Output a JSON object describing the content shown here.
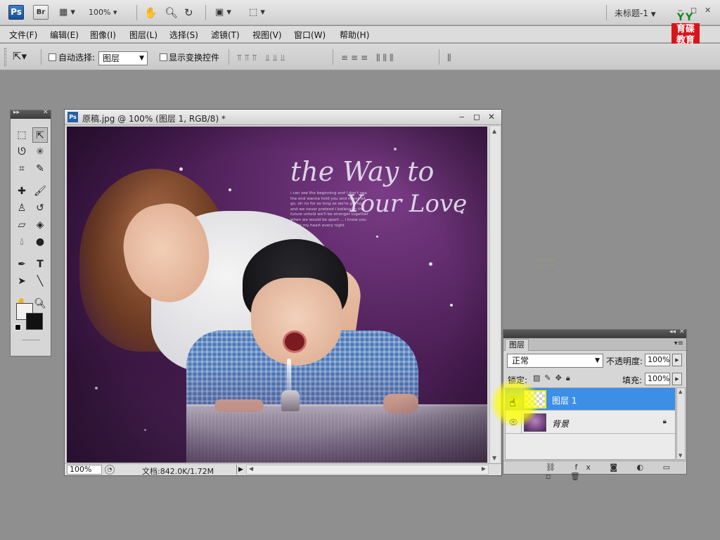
{
  "appbar": {
    "ps_logo": "Ps",
    "br_logo": "Br",
    "zoom": "100%",
    "doc_title": "未标题-1",
    "dropdown_glyph": "▼",
    "minimize_glyph": "‒",
    "restore_glyph": "◻",
    "close_glyph": "✕",
    "edu_top": "YY",
    "edu_line1": "育碟",
    "edu_line2": "教育"
  },
  "menu": {
    "items": [
      {
        "label": "文件(F)"
      },
      {
        "label": "编辑(E)"
      },
      {
        "label": "图像(I)"
      },
      {
        "label": "图层(L)"
      },
      {
        "label": "选择(S)"
      },
      {
        "label": "滤镜(T)"
      },
      {
        "label": "视图(V)"
      },
      {
        "label": "窗口(W)"
      },
      {
        "label": "帮助(H)"
      }
    ]
  },
  "options": {
    "auto_select_label": "自动选择:",
    "auto_select_value": "图层",
    "show_transform_label": "显示变换控件"
  },
  "document": {
    "title": "原稿.jpg @ 100% (图层 1, RGB/8) *",
    "zoom": "100%",
    "doc_size": "文档:842.0K/1.72M",
    "script_line1": "the Way to",
    "script_line2": "Your Love",
    "poem": "i can see the beginning and i don't see the end wanna hold you and never let go, oh no for as long as we're giving and we never pretend i believe in the future untold we'll be stronger together when we would be apart ... i know you made my heart every night"
  },
  "layers_panel": {
    "tab": "图层",
    "blend_mode": "正常",
    "opacity_label": "不透明度:",
    "opacity_value": "100%",
    "lock_label": "锁定:",
    "fill_label": "填充:",
    "fill_value": "100%",
    "layers": [
      {
        "name": "图层 1",
        "selected": true
      },
      {
        "name": "背景",
        "selected": false,
        "locked": true
      }
    ]
  },
  "colors": {
    "selection": "#3d8fe6",
    "highlight": "#ffff00",
    "foreground": "#f2f2f2",
    "background": "#111111"
  }
}
